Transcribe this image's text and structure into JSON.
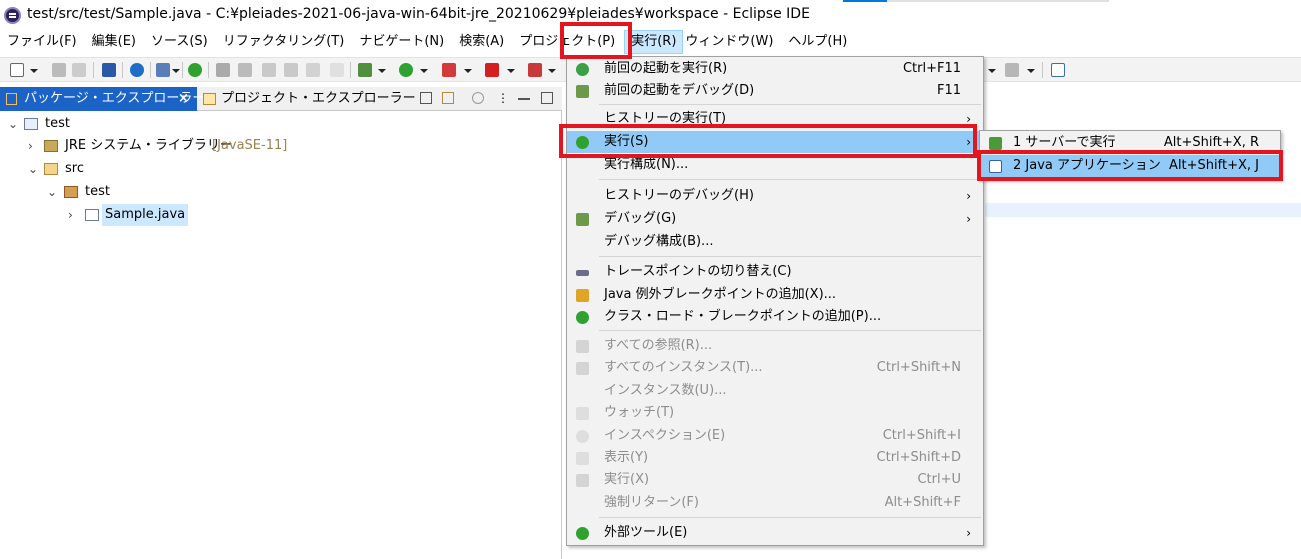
{
  "window": {
    "title": "test/src/test/Sample.java - C:¥pleiades-2021-06-java-win-64bit-jre_20210629¥pleiades¥workspace - Eclipse IDE"
  },
  "menubar": [
    {
      "label": "ファイル(F)"
    },
    {
      "label": "編集(E)"
    },
    {
      "label": "ソース(S)"
    },
    {
      "label": "リファクタリング(T)"
    },
    {
      "label": "ナビゲート(N)"
    },
    {
      "label": "検索(A)"
    },
    {
      "label": "プロジェクト(P)"
    },
    {
      "label": "実行(R)",
      "active": true
    },
    {
      "label": "ウィンドウ(W)"
    },
    {
      "label": "ヘルプ(H)"
    }
  ],
  "left_panel": {
    "tab_active": "パッケージ・エクスプローラー",
    "tab_close": "×",
    "tab_inactive": "プロジェクト・エクスプローラー",
    "tree": {
      "project": "test",
      "library": "JRE システム・ライブラリー",
      "library_version": "[JavaSE-11]",
      "src": "src",
      "package": "test",
      "file": "Sample.java"
    }
  },
  "run_menu": {
    "items": [
      {
        "label": "前回の起動を実行(R)",
        "shortcut": "Ctrl+F11",
        "icon": "run-last-icon"
      },
      {
        "label": "前回の起動をデバッグ(D)",
        "shortcut": "F11",
        "icon": "debug-last-icon"
      },
      {
        "label": "ヒストリーの実行(T)",
        "submenu": true
      },
      {
        "label": "実行(S)",
        "submenu": true,
        "icon": "run-icon",
        "highlighted": true
      },
      {
        "label": "実行構成(N)..."
      },
      {
        "label": "ヒストリーのデバッグ(H)",
        "submenu": true
      },
      {
        "label": "デバッグ(G)",
        "submenu": true,
        "icon": "debug-icon"
      },
      {
        "label": "デバッグ構成(B)..."
      },
      {
        "label": "トレースポイントの切り替え(C)",
        "icon": "tracepoint-icon"
      },
      {
        "label": "Java 例外ブレークポイントの追加(X)...",
        "icon": "exception-breakpoint-icon"
      },
      {
        "label": "クラス・ロード・ブレークポイントの追加(P)...",
        "icon": "class-load-icon"
      },
      {
        "label": "すべての参照(R)...",
        "disabled": true
      },
      {
        "label": "すべてのインスタンス(T)...",
        "shortcut": "Ctrl+Shift+N",
        "disabled": true
      },
      {
        "label": "インスタンス数(U)...",
        "disabled": true
      },
      {
        "label": "ウォッチ(T)",
        "disabled": true
      },
      {
        "label": "インスペクション(E)",
        "shortcut": "Ctrl+Shift+I",
        "disabled": true
      },
      {
        "label": "表示(Y)",
        "shortcut": "Ctrl+Shift+D",
        "disabled": true
      },
      {
        "label": "実行(X)",
        "shortcut": "Ctrl+U",
        "disabled": true
      },
      {
        "label": "強制リターン(F)",
        "shortcut": "Alt+Shift+F",
        "disabled": true
      },
      {
        "label": "外部ツール(E)",
        "submenu": true,
        "icon": "external-tools-icon"
      }
    ],
    "submenu_arrow": "›"
  },
  "run_submenu": {
    "items": [
      {
        "label": "1 サーバーで実行",
        "shortcut": "Alt+Shift+X, R"
      },
      {
        "label": "2 Java アプリケーション",
        "shortcut": "Alt+Shift+X, J",
        "highlighted": true
      }
    ]
  },
  "colors": {
    "highlight_red": "#e3151f",
    "menu_hover": "#91c9f7",
    "active_tab": "#1b63c6"
  }
}
